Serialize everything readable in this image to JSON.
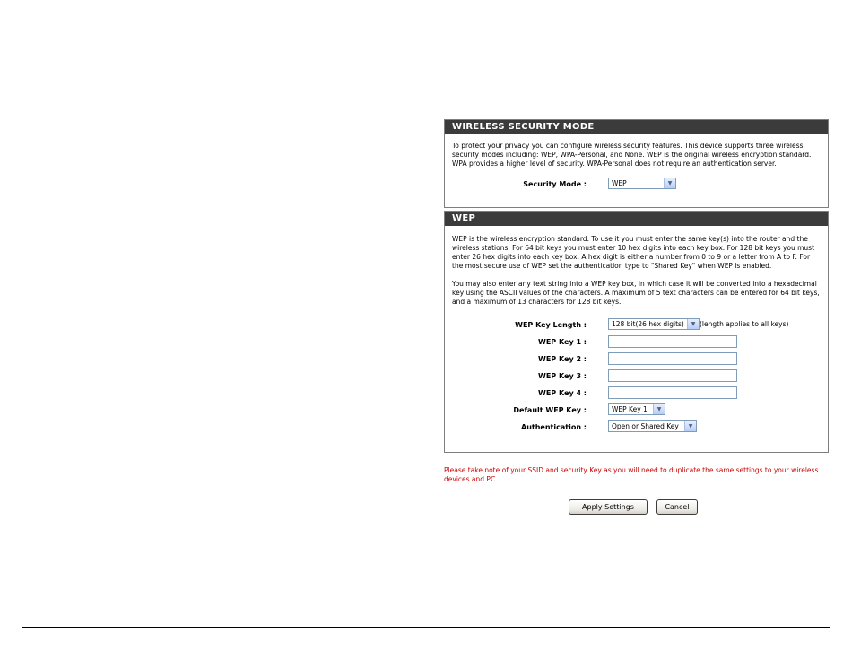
{
  "security_mode": {
    "header": "WIRELESS SECURITY MODE",
    "description": "To protect your privacy you can configure wireless security features. This device supports three wireless security modes including: WEP, WPA-Personal, and None. WEP is the original wireless encryption standard. WPA provides a higher level of security. WPA-Personal does not require an authentication server.",
    "mode_label": "Security Mode :",
    "mode_value": "WEP"
  },
  "wep": {
    "header": "WEP",
    "description1": "WEP is the wireless encryption standard. To use it you must enter the same key(s) into the router and the wireless stations. For 64 bit keys you must enter 10 hex digits into each key box. For 128 bit keys you must enter 26 hex digits into each key box. A hex digit is either a number from 0 to 9 or a letter from A to F. For the most secure use of WEP set the authentication type to \"Shared Key\" when WEP is enabled.",
    "description2": "You may also enter any text string into a WEP key box, in which case it will be converted into a hexadecimal key using the ASCII values of the characters. A maximum of 5 text characters can be entered for 64 bit keys, and a maximum of 13 characters for 128 bit keys.",
    "key_length_label": "WEP Key Length :",
    "key_length_value": "128 bit(26 hex digits)",
    "key_length_note": "(length applies to all keys)",
    "key1_label": "WEP Key 1 :",
    "key1_value": "",
    "key2_label": "WEP Key 2 :",
    "key2_value": "",
    "key3_label": "WEP Key 3 :",
    "key3_value": "",
    "key4_label": "WEP Key 4 :",
    "key4_value": "",
    "default_key_label": "Default WEP Key :",
    "default_key_value": "WEP Key 1",
    "auth_label": "Authentication :",
    "auth_value": "Open or Shared Key"
  },
  "note": "Please take note of your SSID and security Key as you will need to duplicate the same settings to your wireless devices and PC.",
  "buttons": {
    "apply": "Apply Settings",
    "cancel": "Cancel"
  },
  "icons": {
    "dropdown": "chevron-down-icon"
  },
  "colors": {
    "header_bg": "#3b3b3b",
    "note_text": "#cc0000"
  }
}
